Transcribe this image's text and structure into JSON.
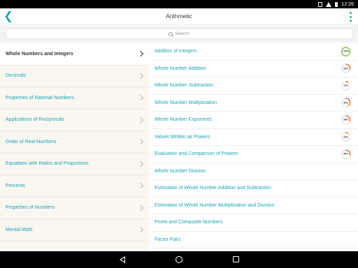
{
  "status_bar": {
    "time": "12:26"
  },
  "app_bar": {
    "title": "Arithmetic"
  },
  "search": {
    "placeholder": "Search"
  },
  "sidebar": {
    "items": [
      {
        "label": "Whole Numbers and Integers",
        "active": true
      },
      {
        "label": "Decimals"
      },
      {
        "label": "Properties of Rational Numbers"
      },
      {
        "label": "Applications of Reciprocals"
      },
      {
        "label": "Order of Real Numbers"
      },
      {
        "label": "Equations with Ratios and Proportions"
      },
      {
        "label": "Percents"
      },
      {
        "label": "Properties of Numbers"
      },
      {
        "label": "Mental Math"
      }
    ]
  },
  "topics": [
    {
      "label": "Addition of Integers",
      "progress": 100,
      "progress_label": "100%",
      "color": "#8bc34a"
    },
    {
      "label": "Whole Number Addition",
      "progress": 30,
      "progress_label": "30%",
      "color": "#f26522"
    },
    {
      "label": "Whole Number Subtraction",
      "progress": 10,
      "progress_label": "10%",
      "color": "#f26522"
    },
    {
      "label": "Whole Number Multiplication",
      "progress": 40,
      "progress_label": "40%",
      "color": "#f26522"
    },
    {
      "label": "Whole Number Exponents",
      "progress": 30,
      "progress_label": "30%",
      "color": "#f26522"
    },
    {
      "label": "Values Written as Powers",
      "progress": 10,
      "progress_label": "10%",
      "color": "#f26522"
    },
    {
      "label": "Evaluation and Comparison of Powers",
      "progress": 30,
      "progress_label": "30%",
      "color": "#f26522"
    },
    {
      "label": "Whole Number Division"
    },
    {
      "label": "Estimation of Whole Number Addition and Subtraction"
    },
    {
      "label": "Estimation of Whole Number Multiplication and Division"
    },
    {
      "label": "Prime and Composite Numbers"
    },
    {
      "label": "Factor Pairs"
    }
  ],
  "colors": {
    "accent": "#1aa4b6",
    "menu": "#2ab27b",
    "sidebar_bg": "#f9f7f0"
  }
}
